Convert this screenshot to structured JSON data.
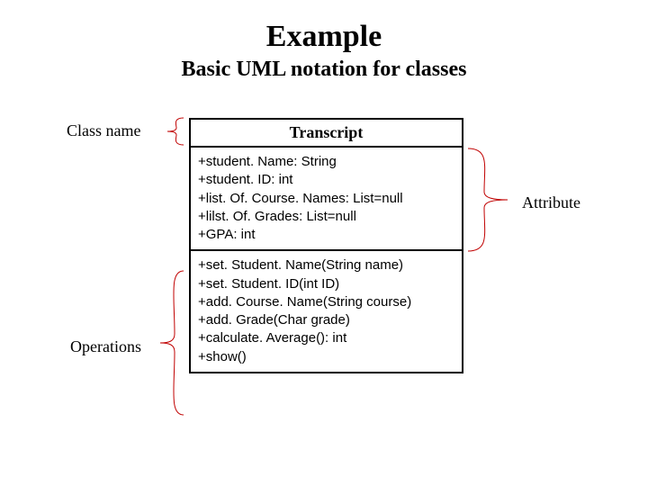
{
  "title": "Example",
  "subtitle": "Basic UML notation for classes",
  "labels": {
    "class_name": "Class  name",
    "attribute": "Attribute",
    "operations": "Operations"
  },
  "uml": {
    "class_name": "Transcript",
    "attributes": [
      "+student. Name: String",
      "+student. ID: int",
      "+list. Of. Course. Names: List=null",
      "+lilst. Of. Grades: List=null",
      "+GPA: int"
    ],
    "operations": [
      "+set. Student. Name(String name)",
      "+set. Student. ID(int ID)",
      "+add. Course. Name(String course)",
      "+add. Grade(Char grade)",
      "+calculate. Average(): int",
      "+show()"
    ]
  }
}
